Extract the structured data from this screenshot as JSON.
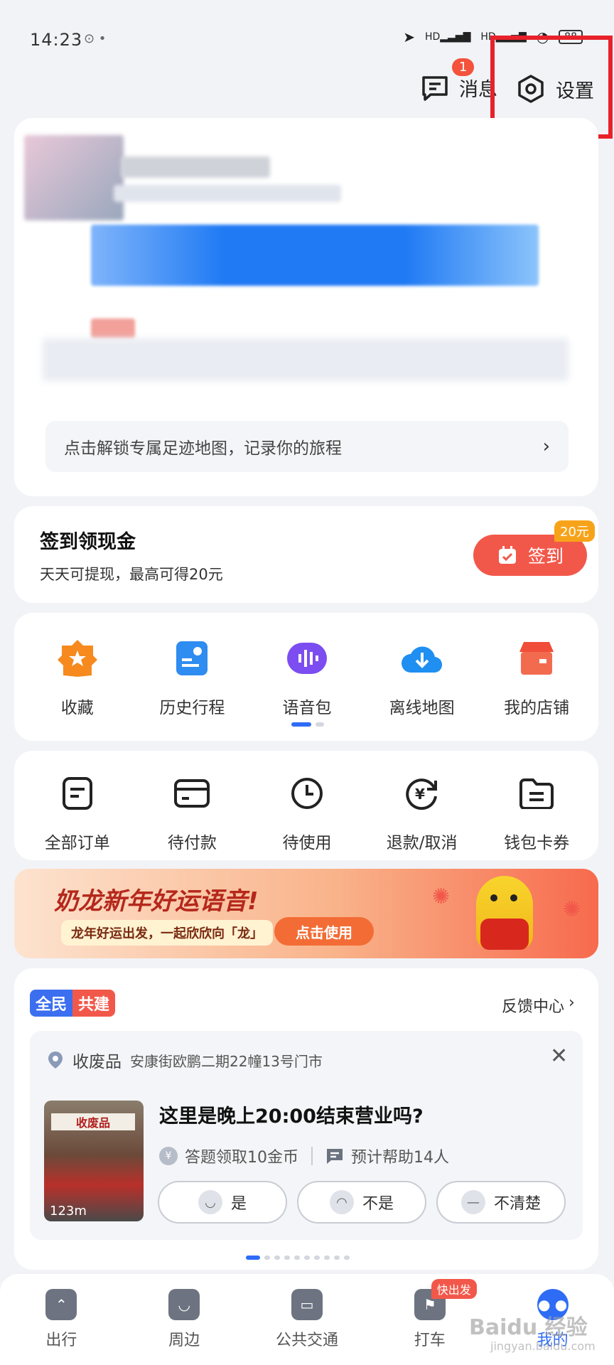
{
  "status_bar": {
    "time": "14:23",
    "signal_label": "HD",
    "battery": "88"
  },
  "header": {
    "messages_label": "消息",
    "messages_badge": "1",
    "settings_label": "设置"
  },
  "profile": {
    "footprint_text": "点击解锁专属足迹地图，记录你的旅程"
  },
  "sign_in": {
    "title": "签到领现金",
    "subtitle": "天天可提现，最高可得20元",
    "button_label": "签到",
    "reward_badge": "20元"
  },
  "tools": {
    "items": [
      {
        "label": "收藏",
        "icon": "star-icon"
      },
      {
        "label": "历史行程",
        "icon": "history-trip-icon"
      },
      {
        "label": "语音包",
        "icon": "voice-pack-icon"
      },
      {
        "label": "离线地图",
        "icon": "offline-map-icon"
      },
      {
        "label": "我的店铺",
        "icon": "shop-icon"
      }
    ]
  },
  "orders": {
    "items": [
      {
        "label": "全部订单",
        "icon": "order-list-icon"
      },
      {
        "label": "待付款",
        "icon": "wallet-card-icon"
      },
      {
        "label": "待使用",
        "icon": "clock-icon"
      },
      {
        "label": "退款/取消",
        "icon": "refund-icon"
      },
      {
        "label": "钱包卡券",
        "icon": "coupon-folder-icon"
      }
    ]
  },
  "banner": {
    "title": "奶龙新年好运语音!",
    "subtitle": "龙年好运出发，一起欣欣向「龙」",
    "button_label": "点击使用"
  },
  "crowdsource": {
    "tag_a": "全民",
    "tag_b": "共建",
    "feedback_link": "反馈中心",
    "poi_category": "收废品",
    "poi_address": "安康街欧鹏二期22幢13号门市",
    "question": "这里是晚上20:00结束营业吗?",
    "reward_text": "答题领取10金币",
    "help_text": "预计帮助14人",
    "photo_distance": "123m",
    "photo_sign": "收废品",
    "answers": [
      "是",
      "不是",
      "不清楚"
    ]
  },
  "bottom_nav": {
    "items": [
      {
        "label": "出行",
        "icon": "travel-icon"
      },
      {
        "label": "周边",
        "icon": "nearby-icon"
      },
      {
        "label": "公共交通",
        "icon": "bus-icon"
      },
      {
        "label": "打车",
        "icon": "taxi-icon",
        "badge": "快出发"
      },
      {
        "label": "我的",
        "icon": "profile-icon"
      }
    ]
  },
  "watermark": {
    "text": "Baidu 经验",
    "url_text": "jingyan.baidu.com"
  },
  "colors": {
    "accent_blue": "#2e6cf6",
    "accent_red": "#f2584a",
    "highlight_box": "#e8212a"
  }
}
